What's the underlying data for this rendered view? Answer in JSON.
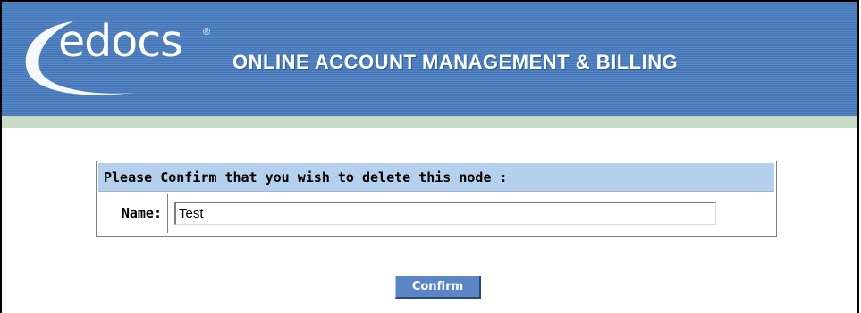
{
  "banner": {
    "logo_text": "edocs",
    "logo_mark": "®",
    "title": "ONLINE ACCOUNT MANAGEMENT & BILLING"
  },
  "confirm": {
    "header": "Please Confirm that you wish to delete this node :",
    "name_label": "Name:",
    "name_value": "Test",
    "button_label": "Confirm"
  },
  "colors": {
    "banner_blue": "#4d80c0",
    "banner_stripe": "#c6dcc6",
    "header_bg": "#b4d0ec",
    "button_bg": "#5a86c8"
  },
  "icons": {
    "logo_swoosh": "swoosh-icon"
  }
}
